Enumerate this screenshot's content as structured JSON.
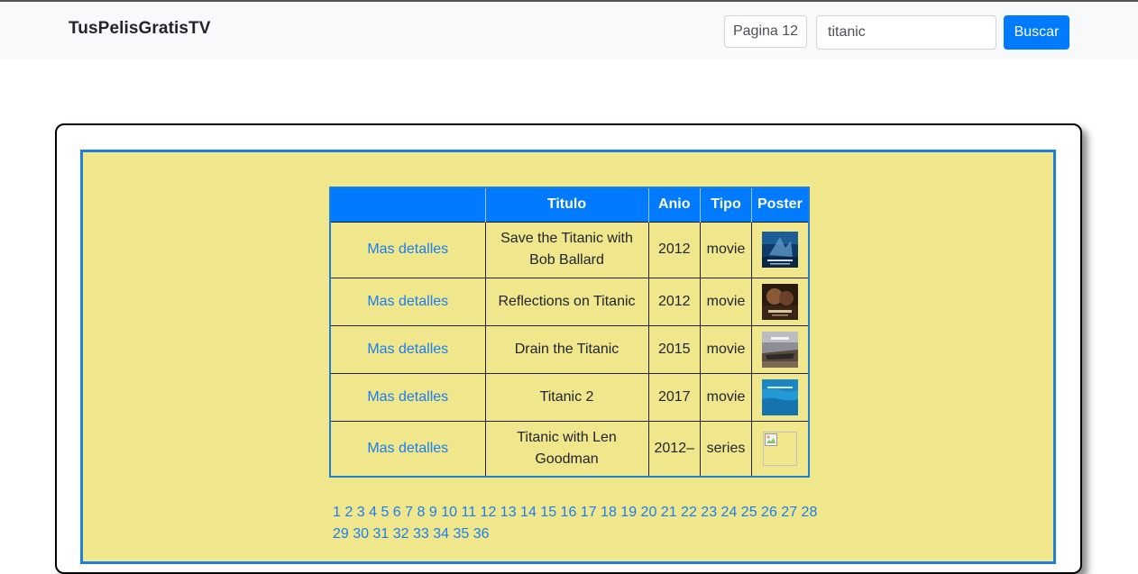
{
  "navbar": {
    "brand": "TusPelisGratisTV",
    "page_label": "Pagina 12",
    "search_value": "titanic",
    "search_button": "Buscar"
  },
  "table": {
    "headers": [
      "",
      "Titulo",
      "Anio",
      "Tipo",
      "Poster"
    ],
    "rows": [
      {
        "link": "Mas detalles",
        "title": "Save the Titanic with Bob Ballard",
        "year": "2012",
        "type": "movie",
        "poster": "poster-titanic-ballard"
      },
      {
        "link": "Mas detalles",
        "title": "Reflections on Titanic",
        "year": "2012",
        "type": "movie",
        "poster": "poster-reflections"
      },
      {
        "link": "Mas detalles",
        "title": "Drain the Titanic",
        "year": "2015",
        "type": "movie",
        "poster": "poster-drain"
      },
      {
        "link": "Mas detalles",
        "title": "Titanic 2",
        "year": "2017",
        "type": "movie",
        "poster": "poster-titanic2"
      },
      {
        "link": "Mas detalles",
        "title": "Titanic with Len Goodman",
        "year": "2012–",
        "type": "series",
        "poster": "broken-image"
      }
    ]
  },
  "pagination": [
    "1",
    "2",
    "3",
    "4",
    "5",
    "6",
    "7",
    "8",
    "9",
    "10",
    "11",
    "12",
    "13",
    "14",
    "15",
    "16",
    "17",
    "18",
    "19",
    "20",
    "21",
    "22",
    "23",
    "24",
    "25",
    "26",
    "27",
    "28",
    "29",
    "30",
    "31",
    "32",
    "33",
    "34",
    "35",
    "36"
  ],
  "colors": {
    "primary": "#007bff",
    "panel_background": "#f0e68c",
    "panel_border": "#1e7fd8",
    "link": "#1a7ef0"
  }
}
